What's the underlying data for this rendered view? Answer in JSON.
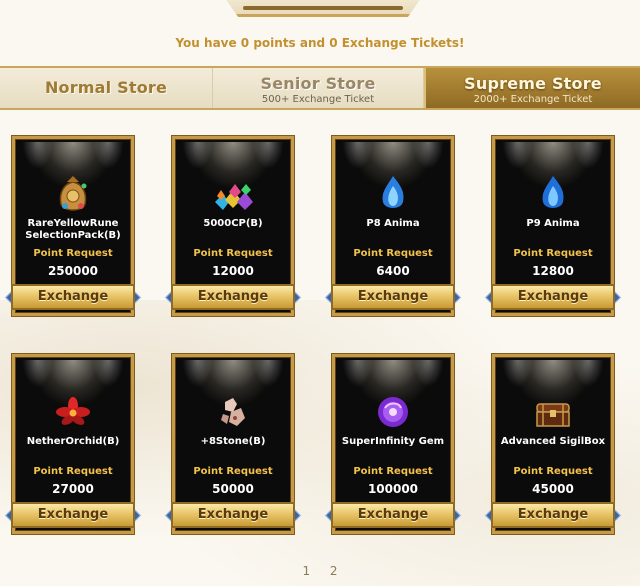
{
  "header": {
    "points_message": "You have 0 points and 0 Exchange Tickets!"
  },
  "tabs": [
    {
      "title": "Normal Store",
      "subtitle": ""
    },
    {
      "title": "Senior Store",
      "subtitle": "500+ Exchange Ticket"
    },
    {
      "title": "Supreme Store",
      "subtitle": "2000+ Exchange Ticket",
      "active": true
    }
  ],
  "items": [
    {
      "name": "RareYellowRune SelectionPack(B)",
      "request_label": "Point Request",
      "points": "250000",
      "button": "Exchange",
      "icon": "rune-bag-icon"
    },
    {
      "name": "5000CP(B)",
      "request_label": "Point Request",
      "points": "12000",
      "button": "Exchange",
      "icon": "gems-pile-icon"
    },
    {
      "name": "P8 Anima",
      "request_label": "Point Request",
      "points": "6400",
      "button": "Exchange",
      "icon": "blue-flame-icon"
    },
    {
      "name": "P9 Anima",
      "request_label": "Point Request",
      "points": "12800",
      "button": "Exchange",
      "icon": "blue-flame-icon"
    },
    {
      "name": "NetherOrchid(B)",
      "request_label": "Point Request",
      "points": "27000",
      "button": "Exchange",
      "icon": "red-flower-icon"
    },
    {
      "name": "+8Stone(B)",
      "request_label": "Point Request",
      "points": "50000",
      "button": "Exchange",
      "icon": "stone-icon"
    },
    {
      "name": "SuperInfinity Gem",
      "request_label": "Point Request",
      "points": "100000",
      "button": "Exchange",
      "icon": "purple-gem-icon"
    },
    {
      "name": "Advanced SigilBox",
      "request_label": "Point Request",
      "points": "45000",
      "button": "Exchange",
      "icon": "chest-icon"
    }
  ],
  "pagination": {
    "pages": [
      "1",
      "2"
    ]
  },
  "colors": {
    "accent_gold": "#c79a45",
    "points_text": "#c2902f",
    "request_text": "#f2c24a",
    "active_tab": "#a8842f"
  }
}
